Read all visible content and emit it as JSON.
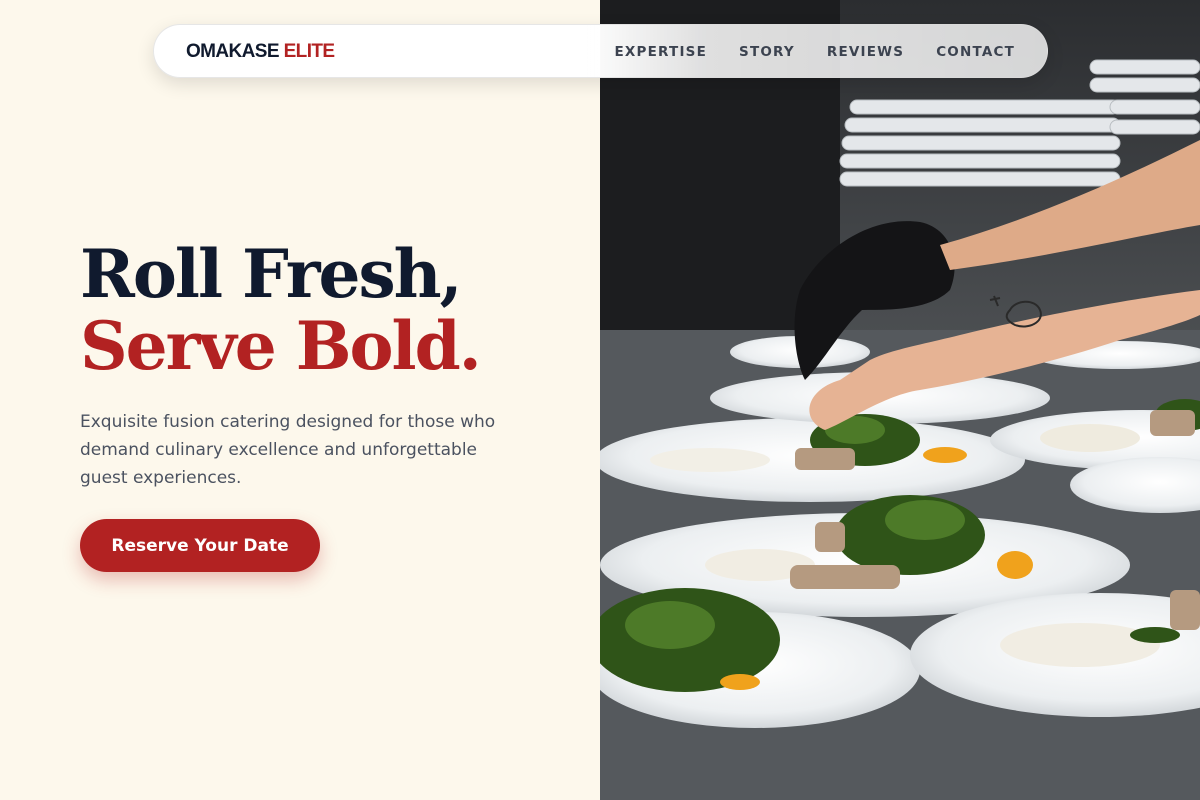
{
  "brand": {
    "name_main": "OMAKASE",
    "name_accent": "ELITE"
  },
  "nav": {
    "items": [
      {
        "label": "EXPERTISE"
      },
      {
        "label": "STORY"
      },
      {
        "label": "REVIEWS"
      },
      {
        "label": "CONTACT"
      }
    ]
  },
  "hero": {
    "title_line1": "Roll Fresh,",
    "title_line2": "Serve Bold.",
    "subtitle": "Exquisite fusion catering designed for those who demand culinary excellence and unforgettable guest experiences.",
    "cta_label": "Reserve Your Date"
  },
  "colors": {
    "accent": "#b22222",
    "navy": "#101a2e",
    "cream": "#fdf8ec"
  }
}
